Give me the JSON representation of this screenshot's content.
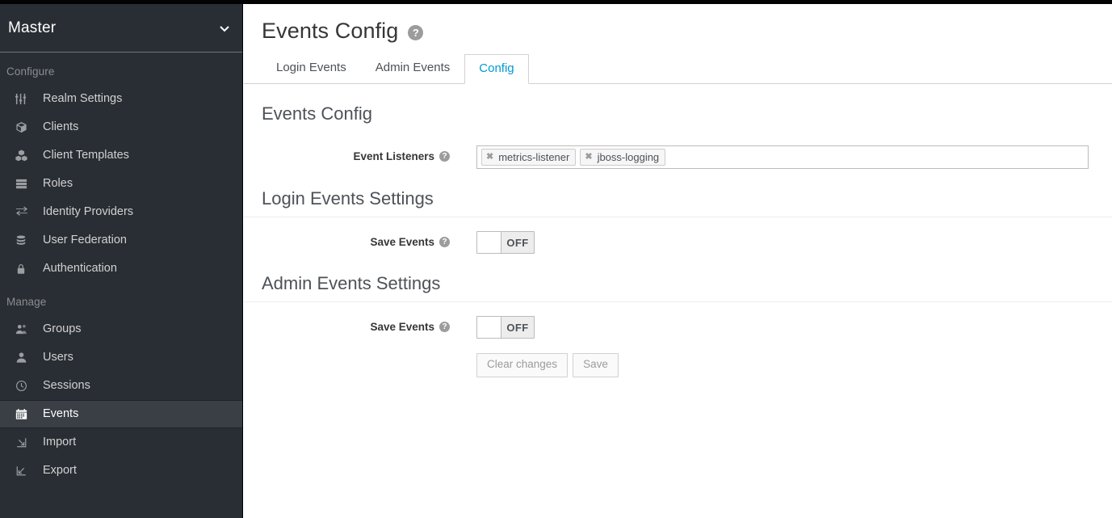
{
  "sidebar": {
    "realm": {
      "name": "Master",
      "chevron_icon": "chevron-down-icon"
    },
    "sections": [
      {
        "label": "Configure",
        "items": [
          {
            "label": "Realm Settings",
            "icon": "sliders-icon",
            "active": false
          },
          {
            "label": "Clients",
            "icon": "cube-icon",
            "active": false
          },
          {
            "label": "Client Templates",
            "icon": "cubes-icon",
            "active": false
          },
          {
            "label": "Roles",
            "icon": "server-list-icon",
            "active": false
          },
          {
            "label": "Identity Providers",
            "icon": "exchange-arrows-icon",
            "active": false
          },
          {
            "label": "User Federation",
            "icon": "database-icon",
            "active": false
          },
          {
            "label": "Authentication",
            "icon": "lock-icon",
            "active": false
          }
        ]
      },
      {
        "label": "Manage",
        "items": [
          {
            "label": "Groups",
            "icon": "users-group-icon",
            "active": false
          },
          {
            "label": "Users",
            "icon": "user-icon",
            "active": false
          },
          {
            "label": "Sessions",
            "icon": "clock-icon",
            "active": false
          },
          {
            "label": "Events",
            "icon": "calendar-icon",
            "active": true
          },
          {
            "label": "Import",
            "icon": "import-arrow-icon",
            "active": false
          },
          {
            "label": "Export",
            "icon": "export-arrow-icon",
            "active": false
          }
        ]
      }
    ]
  },
  "page": {
    "title": "Events Config",
    "help_icon": "question-mark-icon",
    "help_glyph": "?"
  },
  "tabs": [
    {
      "label": "Login Events",
      "active": false
    },
    {
      "label": "Admin Events",
      "active": false
    },
    {
      "label": "Config",
      "active": true
    }
  ],
  "form": {
    "heading": "Events Config",
    "event_listeners": {
      "label": "Event Listeners",
      "help_glyph": "?",
      "chips": [
        {
          "label": "metrics-listener",
          "remove_glyph": "✖"
        },
        {
          "label": "jboss-logging",
          "remove_glyph": "✖"
        }
      ]
    },
    "login_events": {
      "heading": "Login Events Settings",
      "save_events": {
        "label": "Save Events",
        "help_glyph": "?",
        "state": "OFF"
      }
    },
    "admin_events": {
      "heading": "Admin Events Settings",
      "save_events": {
        "label": "Save Events",
        "help_glyph": "?",
        "state": "OFF"
      }
    },
    "buttons": {
      "clear": "Clear changes",
      "save": "Save"
    }
  },
  "colors": {
    "sidebar_bg": "#292e34",
    "sidebar_active_bg": "#393f45",
    "accent_blue": "#0099d3",
    "text_dark": "#363636"
  }
}
